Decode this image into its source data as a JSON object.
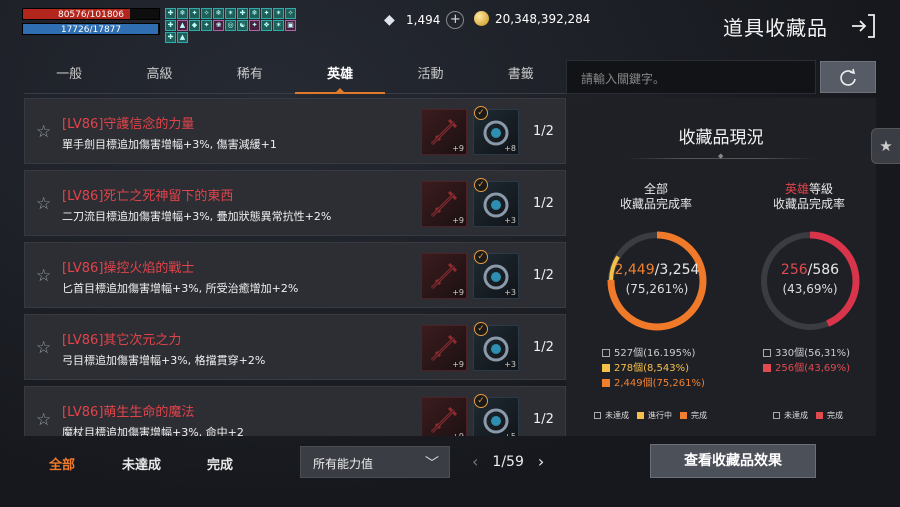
{
  "hud": {
    "hp": "80576/101806",
    "mp": "17726/17877",
    "buffs": [
      "✚",
      "❄",
      "✦",
      "✧",
      "❄",
      "✶",
      "✚",
      "❄",
      "✦",
      "✶",
      "✧",
      "✚",
      "▲",
      "◆",
      "✦",
      "❀",
      "◎",
      "☯",
      "✦",
      "❖",
      "✶",
      "▣",
      "✚",
      "▲"
    ]
  },
  "currency": {
    "diamonds": "1,494",
    "gold": "20,348,392,284"
  },
  "header": {
    "title": "道具收藏品"
  },
  "tabs": [
    "一般",
    "高級",
    "稀有",
    "英雄",
    "活動",
    "書籤"
  ],
  "active_tab": 3,
  "search": {
    "placeholder": "請輸入關鍵字。"
  },
  "rows": [
    {
      "title": "[LV86]守護信念的力量",
      "desc": "單手劍目標追加傷害增幅+3%, 傷害減緩+1",
      "lvl1": "+9",
      "lvl2": "+8",
      "count": "1/2"
    },
    {
      "title": "[LV86]死亡之死神留下的東西",
      "desc": "二刀流目標追加傷害增幅+3%, 疊加狀態異常抗性+2%",
      "lvl1": "+9",
      "lvl2": "+3",
      "count": "1/2"
    },
    {
      "title": "[LV86]操控火焰的戰士",
      "desc": "匕首目標追加傷害增幅+3%, 所受治癒增加+2%",
      "lvl1": "+9",
      "lvl2": "+3",
      "count": "1/2"
    },
    {
      "title": "[LV86]其它次元之力",
      "desc": "弓目標追加傷害增幅+3%, 格擋貫穿+2%",
      "lvl1": "+9",
      "lvl2": "+3",
      "count": "1/2"
    },
    {
      "title": "[LV86]萌生生命的魔法",
      "desc": "魔杖目標追加傷害增幅+3%, 命中+2",
      "lvl1": "+9",
      "lvl2": "+5",
      "count": "1/2"
    }
  ],
  "filters": [
    "全部",
    "未達成",
    "完成"
  ],
  "select": {
    "value": "所有能力值"
  },
  "pager": {
    "text": "1/59"
  },
  "view_button": "查看收藏品效果",
  "panel": {
    "title": "收藏品現況",
    "all": {
      "label1": "全部",
      "label2": "收藏品完成率",
      "done": "2,449",
      "total": "/3,254",
      "pct": "(75,261%)",
      "legend": [
        "527個(16.195%)",
        "278個(8,543%)",
        "2,449個(75,261%)"
      ],
      "keys": [
        "未達成",
        "進行中",
        "完成"
      ]
    },
    "hero": {
      "label1_red": "英雄",
      "label1_rest": "等級",
      "label2": "收藏品完成率",
      "done": "256",
      "total": "/586",
      "pct": "(43,69%)",
      "legend": [
        "330個(56,31%)",
        "256個(43,69%)"
      ],
      "keys": [
        "未達成",
        "完成"
      ]
    }
  },
  "colors": {
    "accent": "#f07a2a",
    "red": "#e0434a",
    "gold": "#f5c04a"
  },
  "chart_data": [
    {
      "type": "pie",
      "categories": [
        "未達成",
        "進行中",
        "完成"
      ],
      "values": [
        16.195,
        8.543,
        75.261
      ]
    },
    {
      "type": "pie",
      "categories": [
        "未達成",
        "完成"
      ],
      "values": [
        56.31,
        43.69
      ]
    }
  ]
}
